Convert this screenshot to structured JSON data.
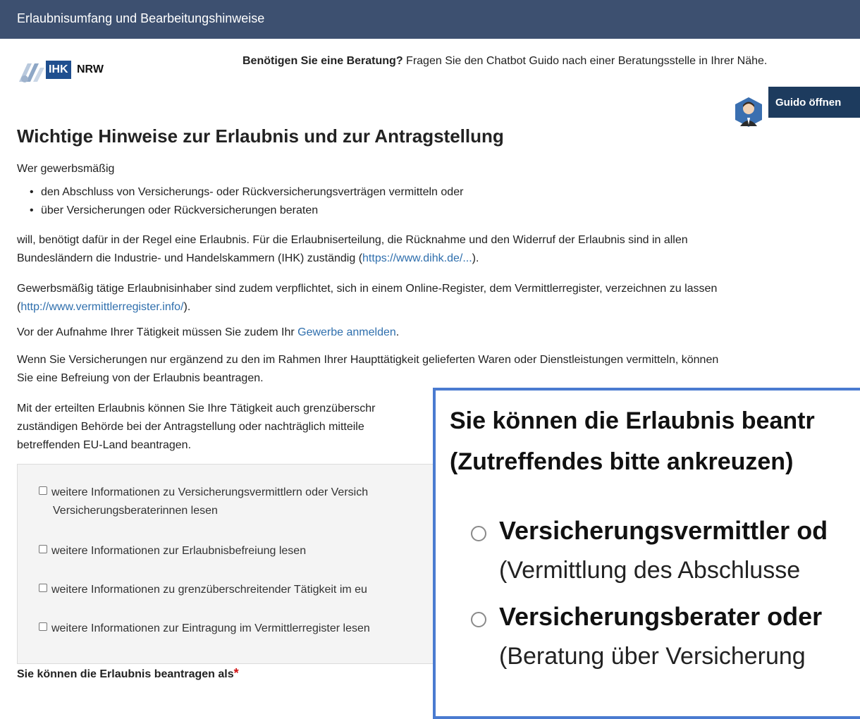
{
  "header": {
    "title": "Erlaubnisumfang und Bearbeitungshinweise"
  },
  "logo": {
    "ihk": "IHK",
    "nrw": "NRW"
  },
  "advice": {
    "question": "Benötigen Sie eine Beratung?",
    "text": "Fragen Sie den Chatbot Guido nach einer Beratungsstelle in Ihrer Nähe."
  },
  "guido": {
    "button_label": "Guido öffnen",
    "avatar_icon": "guido-avatar-icon"
  },
  "main": {
    "heading": "Wichtige Hinweise zur Erlaubnis und zur Antragstellung",
    "intro": "Wer gewerbsmäßig",
    "bullets": [
      "den Abschluss von Versicherungs- oder Rückversicherungsverträgen vermitteln oder",
      "über Versicherungen oder Rückversicherungen beraten"
    ],
    "p1_line1": "will, benötigt dafür in der Regel eine Erlaubnis. Für die Erlaubniserteilung, die Rücknahme und den Widerruf der Erlaubnis sind in allen",
    "p1_line2_pre": "Bundesländern die Industrie- und Handelskammern (IHK) zuständig (",
    "p1_link": "https://www.dihk.de/...",
    "p1_line2_post": ").",
    "p2_line1": "Gewerbsmäßig tätige Erlaubnisinhaber sind zudem verpflichtet, sich in einem Online-Register, dem Vermittlerregister, verzeichnen zu lassen",
    "p2_pre": "(",
    "p2_link": "http://www.vermittlerregister.info/",
    "p2_post": ").",
    "p3_pre": "Vor der Aufnahme Ihrer Tätigkeit müssen Sie zudem Ihr ",
    "p3_link": "Gewerbe anmelden",
    "p3_post": ".",
    "p4_line1": "Wenn Sie Versicherungen nur ergänzend zu den im Rahmen Ihrer Haupttätigkeit gelieferten Waren oder Dienstleistungen vermitteln, können",
    "p4_line2": "Sie eine Befreiung von der Erlaubnis beantragen.",
    "p5_line1": "Mit der erteilten Erlaubnis können Sie Ihre Tätigkeit auch grenzüberschr",
    "p5_line2": "zuständigen Behörde bei der Antragstellung oder nachträglich mitteile",
    "p5_line3": "betreffenden EU-Land beantragen."
  },
  "infobox": {
    "items": [
      {
        "line1": "weitere Informationen zu Versicherungsvermittlern oder Versich",
        "line2": "Versicherungsberaterinnen lesen"
      },
      {
        "line1": "weitere Informationen zur Erlaubnisbefreiung lesen"
      },
      {
        "line1": "weitere Informationen zu grenzüberschreitender Tätigkeit im eu"
      },
      {
        "line1": "weitere Informationen zur Eintragung im Vermittlerregister lesen"
      }
    ]
  },
  "form": {
    "label": "Sie können die Erlaubnis beantragen als",
    "required_mark": "*"
  },
  "zoom": {
    "heading_line1": "Sie können die Erlaubnis beantr",
    "heading_line2": "(Zutreffendes bitte ankreuzen)",
    "options": [
      {
        "title": "Versicherungsvermittler od",
        "sub": "(Vermittlung des Abschlusse"
      },
      {
        "title": "Versicherungsberater oder",
        "sub": "(Beratung über Versicherung"
      }
    ]
  },
  "colors": {
    "header_bg": "#3d5070",
    "button_bg": "#1d3b5e",
    "link": "#2f6fad",
    "zoom_border": "#4a7bd0",
    "required": "#d01010"
  }
}
